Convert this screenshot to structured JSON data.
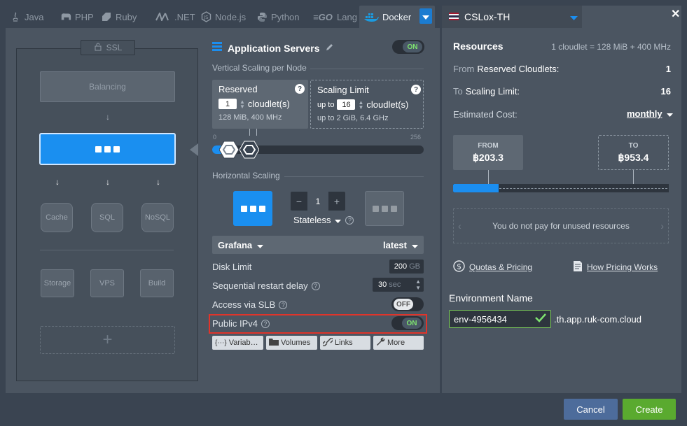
{
  "tabs": [
    {
      "label": "Java",
      "icon": "java-icon"
    },
    {
      "label": "PHP",
      "icon": "php-icon"
    },
    {
      "label": "Ruby",
      "icon": "ruby-icon"
    },
    {
      "label": ".NET",
      "icon": "dotnet-icon"
    },
    {
      "label": "Node.js",
      "icon": "nodejs-icon"
    },
    {
      "label": "Python",
      "icon": "python-icon"
    },
    {
      "label": "Lang",
      "icon": "go-icon"
    },
    {
      "label": "Docker",
      "icon": "docker-icon",
      "active": true
    }
  ],
  "topology": {
    "ssl_label": "SSL",
    "balancing_label": "Balancing",
    "cache_label": "Cache",
    "sql_label": "SQL",
    "nosql_label": "NoSQL",
    "storage_label": "Storage",
    "vps_label": "VPS",
    "build_label": "Build",
    "add_label": "+"
  },
  "config": {
    "title": "Application Servers",
    "toggle_on": "ON",
    "vertical_scaling_label": "Vertical Scaling per Node",
    "reserved": {
      "title": "Reserved",
      "value": "1",
      "unit": "cloudlet(s)",
      "sub": "128 MiB, 400 MHz"
    },
    "scaling_limit": {
      "title": "Scaling Limit",
      "prefix": "up to",
      "value": "16",
      "unit": "cloudlet(s)",
      "sub_prefix": "up to",
      "sub": "2 GiB, 6.4 GHz"
    },
    "slider_min": "0",
    "slider_max": "256",
    "horizontal_scaling_label": "Horizontal Scaling",
    "node_count": "1",
    "minus": "−",
    "plus": "+",
    "stateless_label": "Stateless",
    "image_name": "Grafana",
    "image_tag": "latest",
    "disk_limit_label": "Disk Limit",
    "disk_limit_value": "200",
    "disk_limit_unit": "GB",
    "restart_delay_label": "Sequential restart delay",
    "restart_delay_value": "30",
    "restart_delay_unit": "sec",
    "slb_label": "Access via SLB",
    "slb_value": "OFF",
    "ipv4_label": "Public IPv4",
    "ipv4_value": "ON",
    "buttons": {
      "variables": "Variab…",
      "volumes": "Volumes",
      "links": "Links",
      "more": "More"
    }
  },
  "region": {
    "name": "CSLox-TH"
  },
  "resources": {
    "title": "Resources",
    "cloudlet_info": "1 cloudlet = 128 MiB + 400 MHz",
    "from_prefix": "From",
    "from_label": "Reserved Cloudlets:",
    "from_value": "1",
    "to_prefix": "To",
    "to_label": "Scaling Limit:",
    "to_value": "16",
    "cost_label": "Estimated Cost:",
    "cost_period": "monthly",
    "price_from_label": "FROM",
    "price_from_value": "฿203.3",
    "price_to_label": "TO",
    "price_to_value": "฿953.4",
    "price_from_fraction": 0.21,
    "unused_note": "You do not pay for unused resources",
    "quotas_link": "Quotas & Pricing",
    "pricing_link": "How Pricing Works"
  },
  "environment": {
    "label": "Environment Name",
    "name_value": "env-4956434",
    "domain_suffix": ".th.app.ruk-com.cloud"
  },
  "footer": {
    "cancel": "Cancel",
    "create": "Create"
  },
  "colors": {
    "accent": "#1b7cd1",
    "create": "#5aaa2f",
    "cancel": "#4d6c9b",
    "highlight": "#e0342a",
    "on_text": "#7ee36f"
  }
}
